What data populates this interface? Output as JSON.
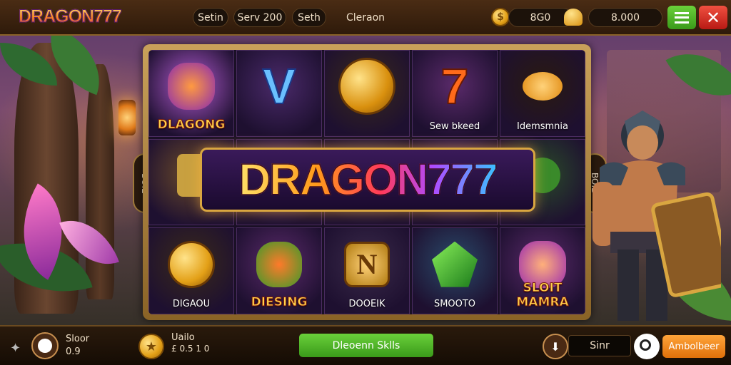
{
  "header": {
    "logo_text": "DRAGON777",
    "tabs": [
      "Setin",
      "Serv 200",
      "Seth",
      "Cleraon"
    ],
    "coin_symbol": "$",
    "balance_a": "8G0",
    "balance_b": "8.000"
  },
  "reels": {
    "title": "DRAGON777",
    "left_tab": "BOIE",
    "right_tab": "BOID",
    "cells": [
      {
        "label": "DLAGONG",
        "big": true
      },
      {
        "label": ""
      },
      {
        "label": ""
      },
      {
        "label": "Sew bkeed"
      },
      {
        "label": "Idemsmnia"
      },
      {
        "label": ""
      },
      {
        "label": ""
      },
      {
        "label": ""
      },
      {
        "label": ""
      },
      {
        "label": ""
      },
      {
        "label": "DIGAOU"
      },
      {
        "label": "DIESING",
        "big": true
      },
      {
        "label": "DOOEIK"
      },
      {
        "label": "SMOOTO"
      },
      {
        "label": "SLOIT MAMRA",
        "big": true
      }
    ],
    "n_symbol_letter": "N"
  },
  "footer": {
    "slot_label": "Sloor",
    "slot_value": "0.9",
    "wallet_label": "Uailo",
    "wallet_value": "£ 0.5 1 0",
    "spin_button": "Dleoenn Sklls",
    "mid_pill": "Sinr",
    "orange_button": "Ambolbeer"
  },
  "colors": {
    "accent_green": "#5cc02a",
    "accent_orange": "#f08a1a",
    "close_red": "#e0302a",
    "frame_gold": "#c9a15a"
  }
}
